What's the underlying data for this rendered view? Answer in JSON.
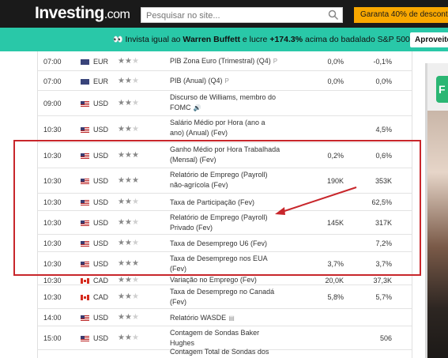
{
  "header": {
    "logo_main": "Investing",
    "logo_suffix": ".com",
    "search_placeholder": "Pesquisar no site...",
    "promo_button": "Garanta 40% de desconto"
  },
  "banner": {
    "text_pre": "Invista igual ao ",
    "name": "Warren Buffett",
    "text_mid": " e lucre ",
    "gain": "+174.3%",
    "text_post": " acima do badalado S&P 500",
    "button": "Aproveite"
  },
  "ad": {
    "logo_letter": "F"
  },
  "rows": [
    {
      "time": "07:00",
      "flag": "eu",
      "currency": "EUR",
      "stars": 2,
      "event": "PIB Zona Euro (Trimestral) (Q4)",
      "tag": "P",
      "actual": "0,0%",
      "forecast": "-0,1%"
    },
    {
      "time": "07:00",
      "flag": "eu",
      "currency": "EUR",
      "stars": 2,
      "event": "PIB (Anual) (Q4)",
      "tag": "P",
      "actual": "0,0%",
      "forecast": "0,0%"
    },
    {
      "time": "09:00",
      "flag": "us",
      "currency": "USD",
      "stars": 2,
      "event": "Discurso de Williams, membro do FOMC",
      "tag": "🔊",
      "actual": "",
      "forecast": ""
    },
    {
      "time": "10:30",
      "flag": "us",
      "currency": "USD",
      "stars": 2,
      "event": "Salário Médio por Hora (ano a ano) (Anual) (Fev)",
      "tag": "",
      "actual": "",
      "forecast": "4,5%"
    },
    {
      "time": "10:30",
      "flag": "us",
      "currency": "USD",
      "stars": 3,
      "event": "Ganho Médio por Hora Trabalhada (Mensal) (Fev)",
      "tag": "",
      "actual": "0,2%",
      "forecast": "0,6%"
    },
    {
      "time": "10:30",
      "flag": "us",
      "currency": "USD",
      "stars": 3,
      "event": "Relatório de Emprego (Payroll) não-agrícola (Fev)",
      "tag": "",
      "actual": "190K",
      "forecast": "353K"
    },
    {
      "time": "10:30",
      "flag": "us",
      "currency": "USD",
      "stars": 2,
      "event": "Taxa de Participação (Fev)",
      "tag": "",
      "actual": "",
      "forecast": "62,5%"
    },
    {
      "time": "10:30",
      "flag": "us",
      "currency": "USD",
      "stars": 2,
      "event": "Relatório de Emprego (Payroll) Privado (Fev)",
      "tag": "",
      "actual": "145K",
      "forecast": "317K"
    },
    {
      "time": "10:30",
      "flag": "us",
      "currency": "USD",
      "stars": 2,
      "event": "Taxa de Desemprego U6 (Fev)",
      "tag": "",
      "actual": "",
      "forecast": "7,2%"
    },
    {
      "time": "10:30",
      "flag": "us",
      "currency": "USD",
      "stars": 3,
      "event": "Taxa de Desemprego nos EUA (Fev)",
      "tag": "",
      "actual": "3,7%",
      "forecast": "3,7%"
    },
    {
      "time": "10:30",
      "flag": "ca",
      "currency": "CAD",
      "stars": 2,
      "event": "Variação no Emprego (Fev)",
      "tag": "",
      "actual": "20,0K",
      "forecast": "37,3K"
    },
    {
      "time": "10:30",
      "flag": "ca",
      "currency": "CAD",
      "stars": 2,
      "event": "Taxa de Desemprego no Canadá (Fev)",
      "tag": "",
      "actual": "5,8%",
      "forecast": "5,7%"
    },
    {
      "time": "14:00",
      "flag": "us",
      "currency": "USD",
      "stars": 2,
      "event": "Relatório WASDE",
      "tag": "▤",
      "actual": "",
      "forecast": ""
    },
    {
      "time": "15:00",
      "flag": "us",
      "currency": "USD",
      "stars": 2,
      "event": "Contagem de Sondas Baker Hughes",
      "tag": "",
      "actual": "",
      "forecast": "506"
    },
    {
      "time": "",
      "flag": "us",
      "currency": "",
      "stars": 0,
      "event": "Contagem Total de Sondas dos",
      "tag": "",
      "actual": "",
      "forecast": ""
    }
  ],
  "colors": {
    "header_bg": "#1a1a1a",
    "banner_bg": "#29c8a8",
    "promo_button": "#f9a800",
    "highlight": "#c8262b"
  }
}
